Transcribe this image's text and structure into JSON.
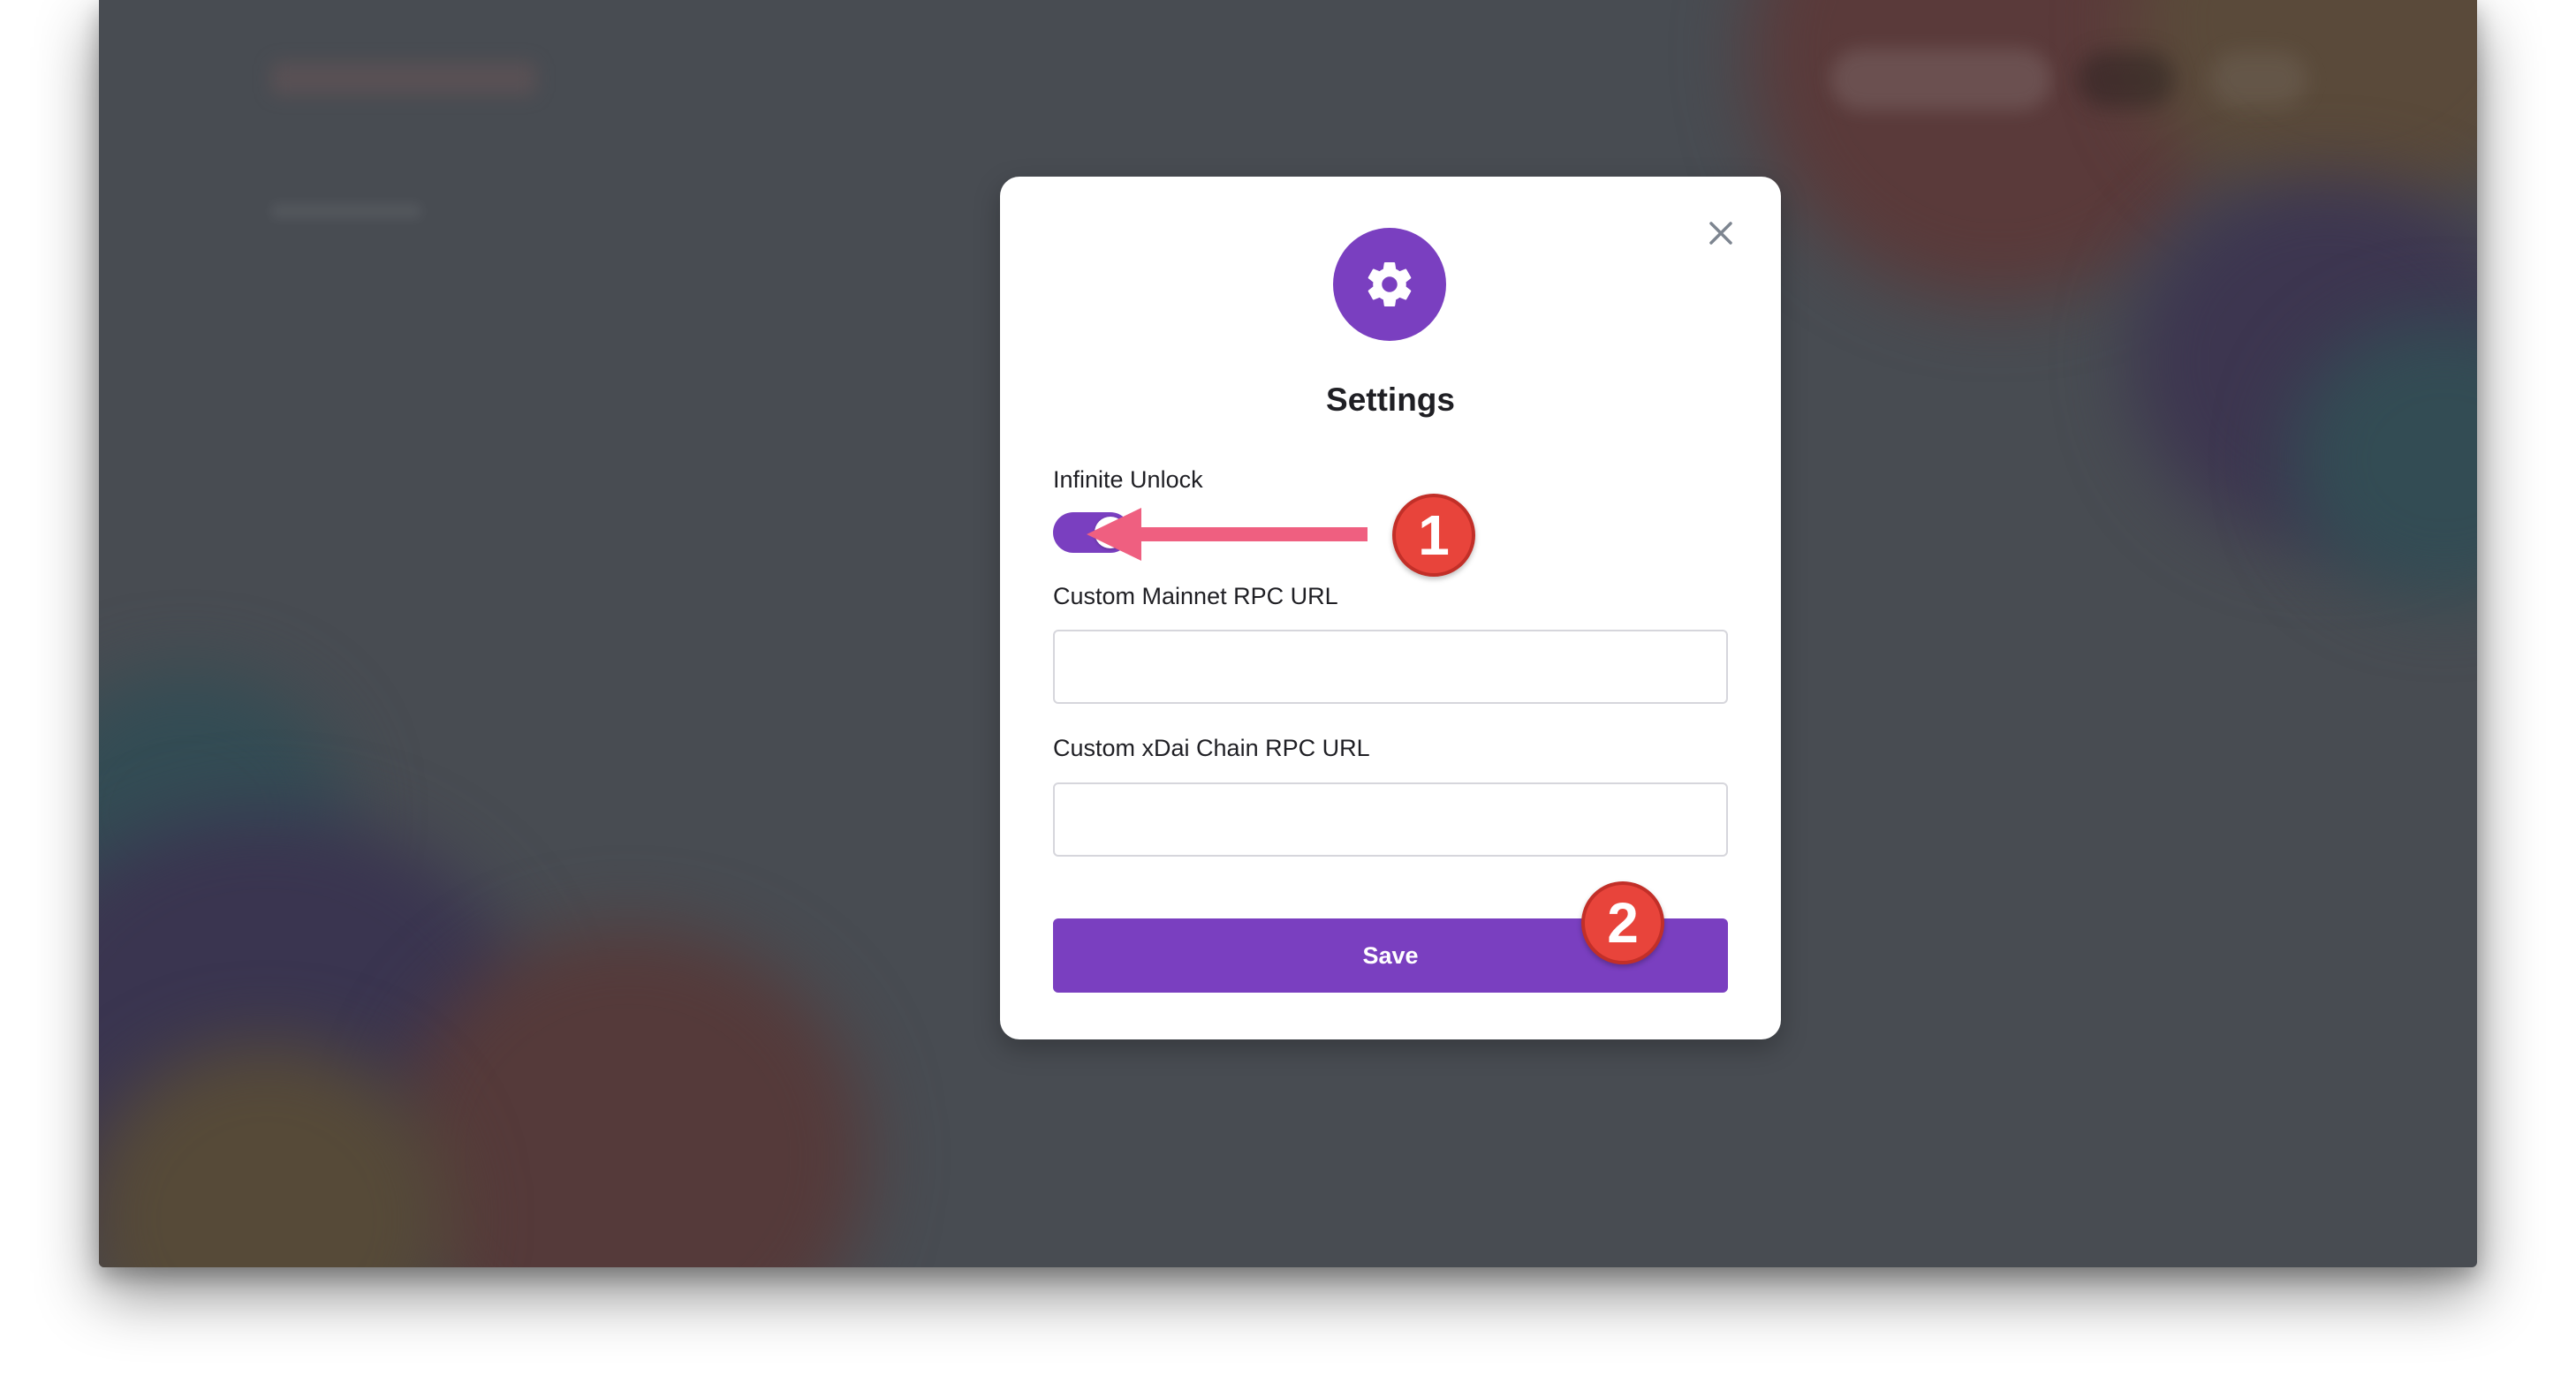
{
  "modal": {
    "title": "Settings",
    "icon": "gear-icon",
    "close_icon": "close-icon",
    "infinite_unlock": {
      "label": "Infinite Unlock",
      "enabled": true
    },
    "mainnet_rpc": {
      "label": "Custom Mainnet RPC URL",
      "value": "",
      "placeholder": ""
    },
    "xdai_rpc": {
      "label": "Custom xDai Chain RPC URL",
      "value": "",
      "placeholder": ""
    },
    "save_label": "Save"
  },
  "annotations": {
    "step_1": "1",
    "step_2": "2",
    "arrow_color": "#ef5f80",
    "badge_color": "#e8443b"
  },
  "colors": {
    "accent": "#7a3fc0",
    "overlay": "#484c52"
  }
}
